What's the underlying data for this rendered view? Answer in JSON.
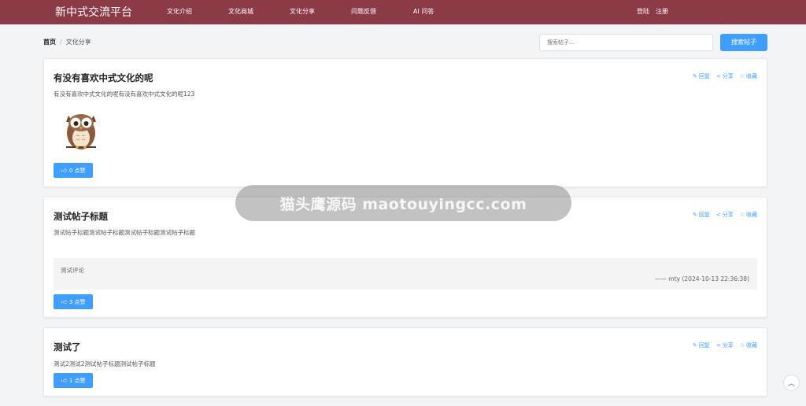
{
  "brand": "新中式交流平台",
  "nav": [
    "文化介绍",
    "文化商城",
    "文化分享",
    "问题反馈",
    "AI 问答"
  ],
  "auth": {
    "login": "登陆",
    "register": "注册"
  },
  "breadcrumb": {
    "home": "首页",
    "sep": "/",
    "current": "文化分享"
  },
  "search": {
    "placeholder": "搜索帖子...",
    "button": "搜索帖子"
  },
  "action_labels": {
    "reply": "回复",
    "share": "分享",
    "favorite": "收藏"
  },
  "posts": [
    {
      "title": "有没有喜欢中式文化的呢",
      "body": "有没有喜欢中式文化的呢有没有喜欢中式文化的呢123",
      "likes": "0 点赞",
      "image": "owl-illustration"
    },
    {
      "title": "测试帖子标题",
      "body": "测试帖子标题测试帖子标题测试帖子标题测试帖子标题",
      "comment": {
        "text": "测试评论",
        "meta": "—— mty (2024-10-13 22:36:38)"
      },
      "likes": "3 点赞"
    },
    {
      "title": "测试了",
      "body": "测试2测试2测试帖子标题测试帖子标题",
      "likes": "1 点赞"
    }
  ],
  "watermark": "猫头鹰源码 maotouyingcc.com",
  "colors": {
    "nav_bg": "#8c3a45",
    "primary": "#409eff",
    "page_bg": "#f3f4f6"
  },
  "icons": {
    "like": "thumbs-up-icon",
    "reply": "edit-icon",
    "share": "share-icon",
    "favorite": "star-icon",
    "to_top": "chevron-up-icon"
  }
}
